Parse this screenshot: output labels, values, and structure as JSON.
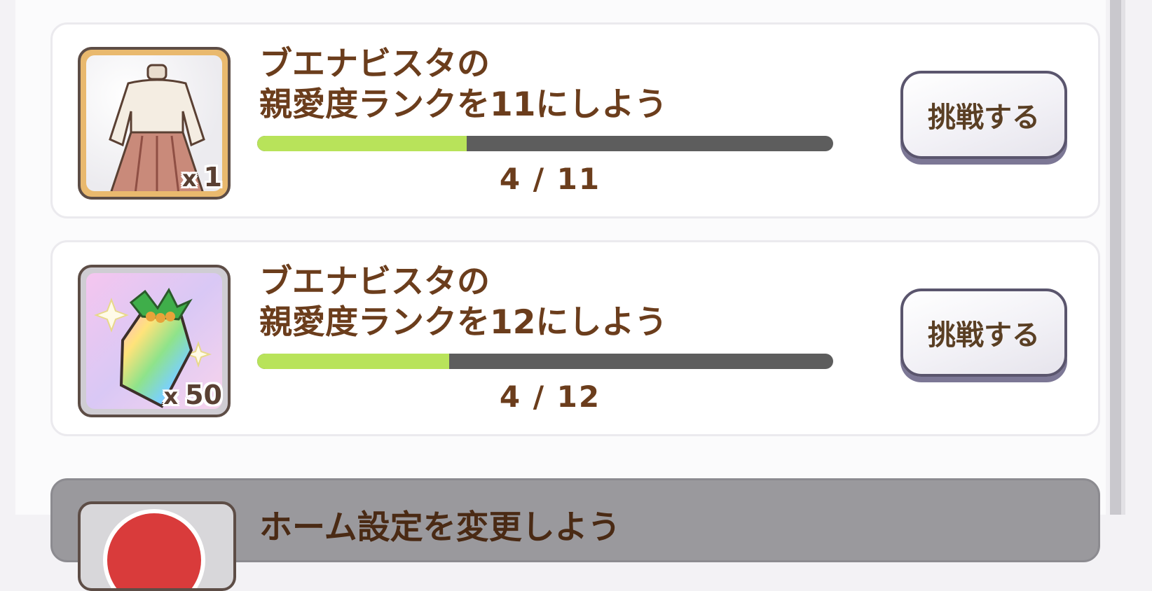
{
  "missions": [
    {
      "title_line1": "ブエナビスタの",
      "title_line2": "親愛度ランクを11にしよう",
      "progress_text": "4 / 11",
      "progress_fraction": 0.364,
      "reward": {
        "icon": "outfit-icon",
        "qty_prefix": "x",
        "qty": "1"
      },
      "button_label": "挑戦する"
    },
    {
      "title_line1": "ブエナビスタの",
      "title_line2": "親愛度ランクを12にしよう",
      "progress_text": "4 / 12",
      "progress_fraction": 0.333,
      "reward": {
        "icon": "rainbow-crystal-icon",
        "qty_prefix": "x",
        "qty": "50"
      },
      "button_label": "挑戦する"
    }
  ],
  "partial_mission": {
    "title": "ホーム設定を変更しよう"
  },
  "colors": {
    "title_text": "#6b3d1c",
    "progress_fill": "#b8e35a",
    "progress_track": "#5d5d5d"
  }
}
